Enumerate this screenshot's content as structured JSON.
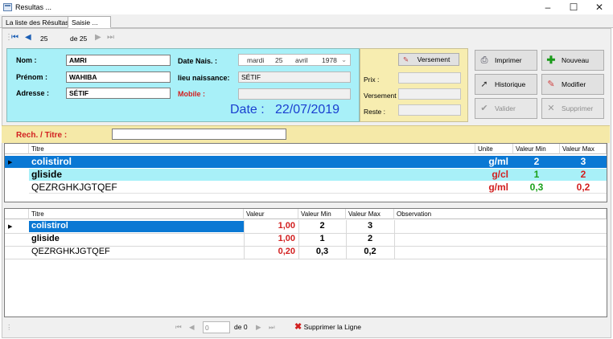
{
  "window": {
    "title": "Resultas ..."
  },
  "tabs": [
    {
      "label": "La liste des Résultas"
    },
    {
      "label": "Saisie ..."
    }
  ],
  "navigator": {
    "position": "25",
    "count": "de 25"
  },
  "patient": {
    "nom_label": "Nom :",
    "nom": "AMRI",
    "prenom_label": "Prénom :",
    "prenom": "WAHIBA",
    "adresse_label": "Adresse :",
    "adresse": "SÉTIF",
    "datenais_label": "Date Nais. :",
    "datenais_day": "mardi",
    "datenais_num": "25",
    "datenais_month": "avril",
    "datenais_year": "1978",
    "lieu_label": "lieu naissance:",
    "lieu": "SÉTIF",
    "mobile_label": "Mobile :",
    "mobile": ""
  },
  "date": {
    "label": "Date :",
    "value": "22/07/2019"
  },
  "payment": {
    "versement_button": "Versement",
    "prix_label": "Prix :",
    "versement_label": "Versement :",
    "reste_label": "Reste :"
  },
  "actions": {
    "imprimer": "Imprimer",
    "nouveau": "Nouveau",
    "historique": "Historique",
    "modifier": "Modifier",
    "valider": "Valider",
    "supprimer": "Supprimer"
  },
  "search": {
    "label": "Rech. / Titre :",
    "value": ""
  },
  "grid1": {
    "headers": {
      "titre": "Titre",
      "unite": "Unite",
      "vmin": "Valeur Min",
      "vmax": "Valeur Max"
    },
    "rows": [
      {
        "titre": "colistirol",
        "unite": "g/ml",
        "vmin": "2",
        "vmax": "3"
      },
      {
        "titre": "gliside",
        "unite": "g/cl",
        "vmin": "1",
        "vmax": "2"
      },
      {
        "titre": "QEZRGHKJGTQEF",
        "unite": "g/ml",
        "vmin": "0,3",
        "vmax": "0,2"
      }
    ]
  },
  "grid2": {
    "headers": {
      "titre": "Titre",
      "valeur": "Valeur",
      "vmin": "Valeur Min",
      "vmax": "Valeur Max",
      "obs": "Observation"
    },
    "rows": [
      {
        "titre": "colistirol",
        "valeur": "1,00",
        "vmin": "2",
        "vmax": "3",
        "obs": ""
      },
      {
        "titre": "gliside",
        "valeur": "1,00",
        "vmin": "1",
        "vmax": "2",
        "obs": ""
      },
      {
        "titre": "QEZRGHKJGTQEF",
        "valeur": "0,20",
        "vmin": "0,3",
        "vmax": "0,2",
        "obs": ""
      }
    ]
  },
  "bottomNav": {
    "position": "0",
    "count": "de 0",
    "delete_label": "Supprimer la Ligne"
  }
}
